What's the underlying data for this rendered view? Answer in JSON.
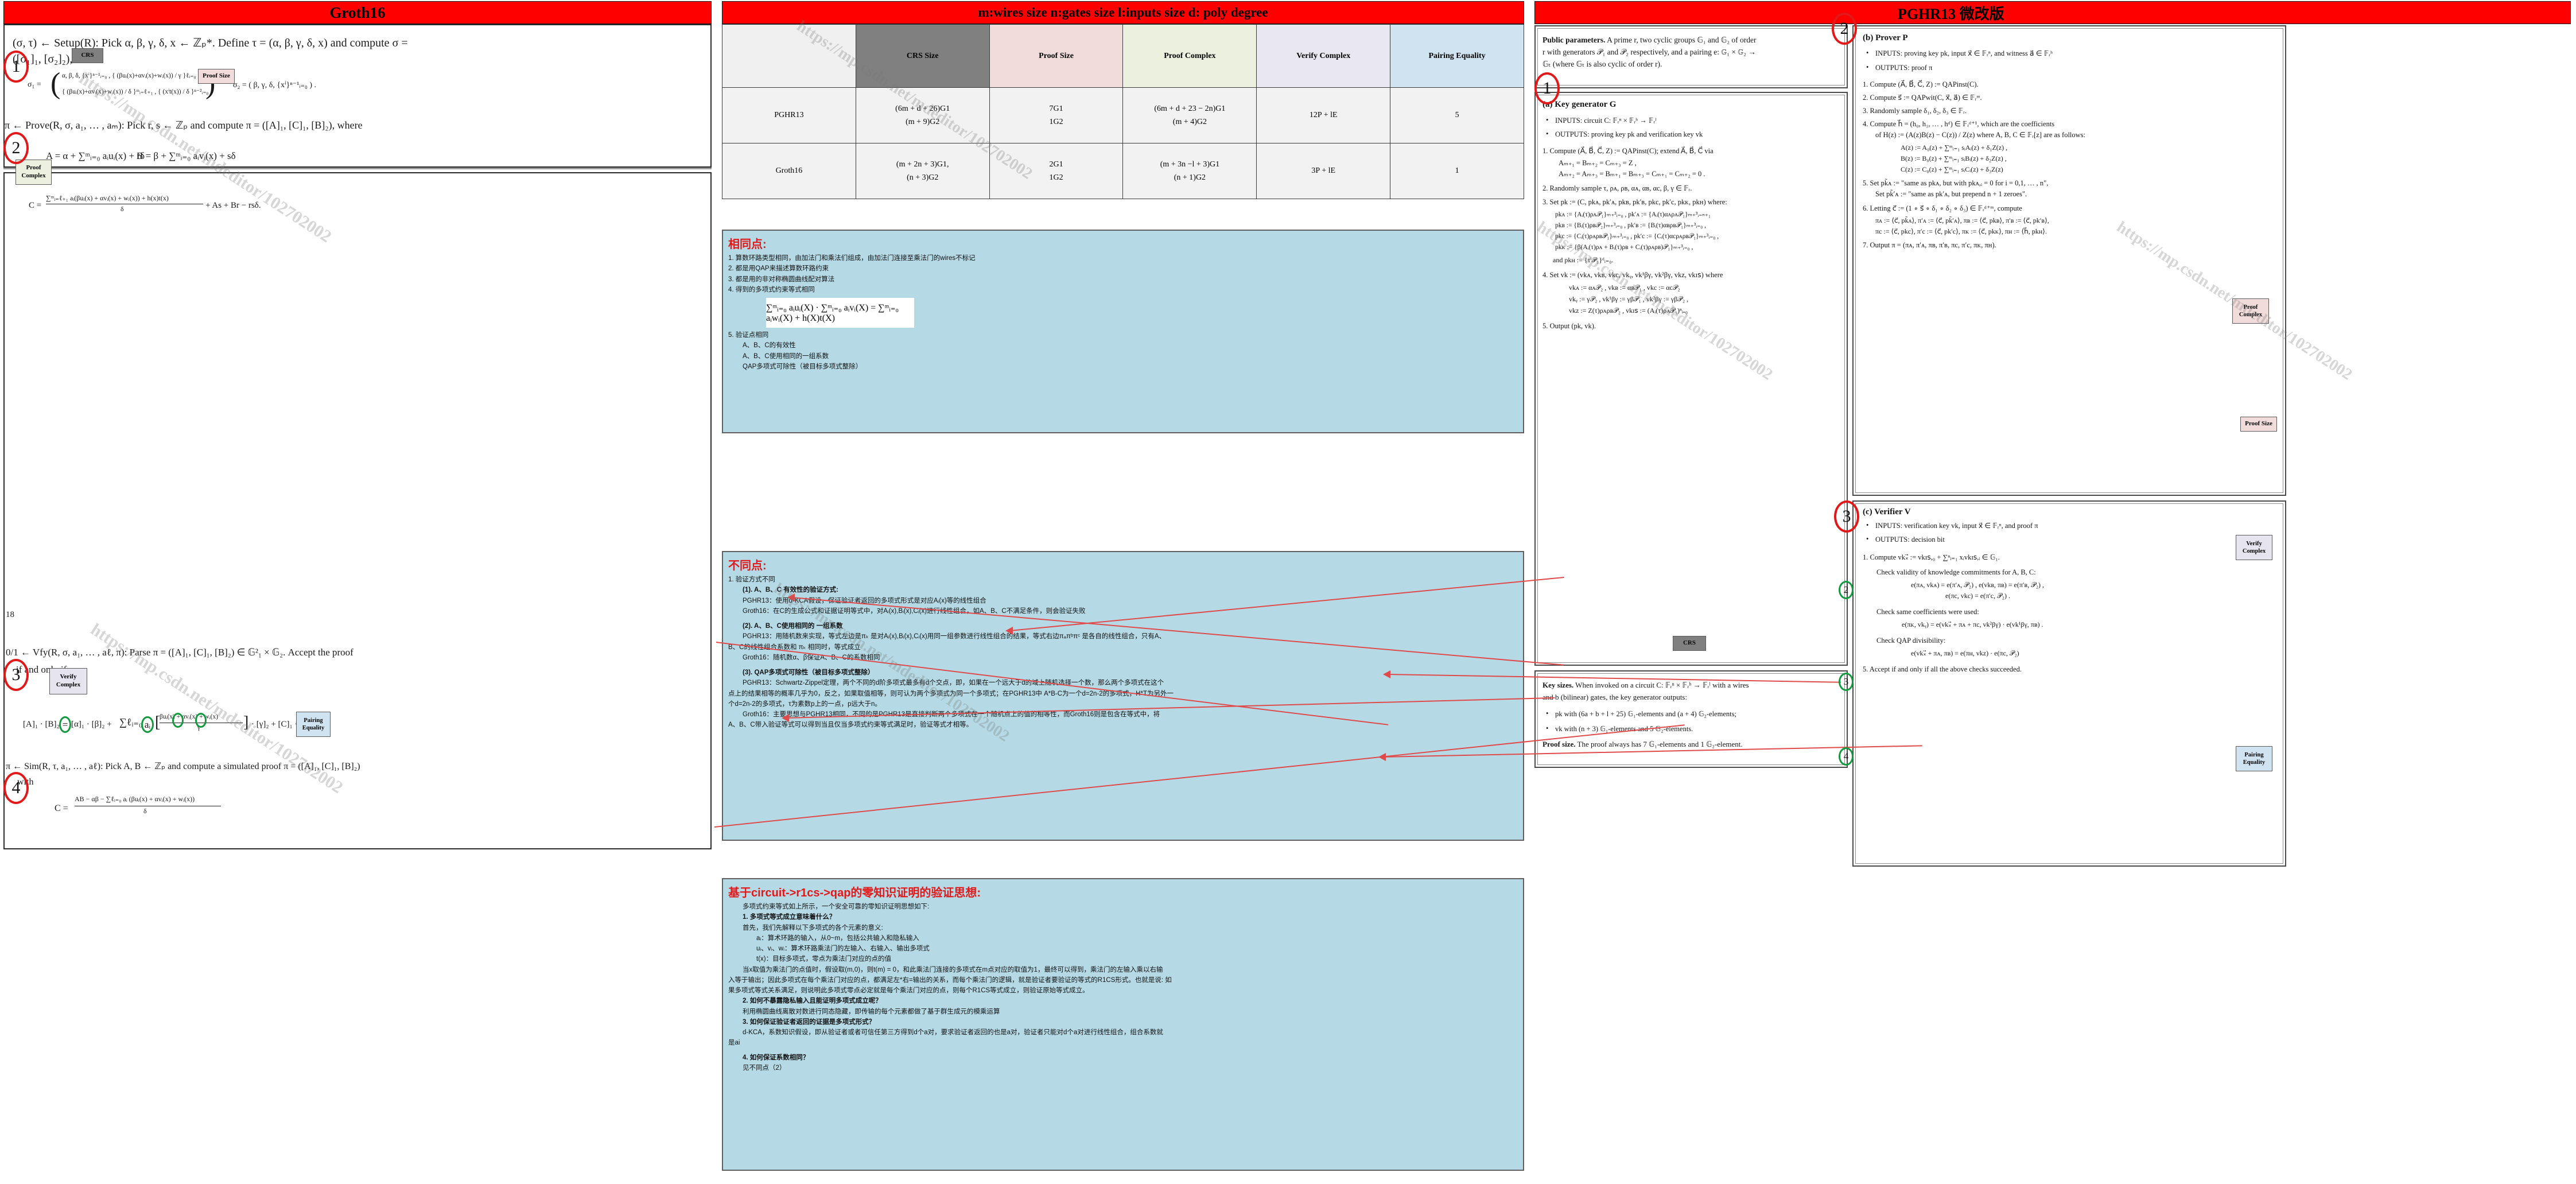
{
  "left": {
    "banner_title": "Groth16",
    "page_number": "18",
    "setup_line1": "(σ, τ) ← Setup(R): Pick α, β, γ, δ, x ← ℤₚ*. Define τ = (α, β, γ, δ, x) and compute σ =",
    "setup_line2": "([σ₁]₁, [σ₂]₂), where",
    "sigma1_row1": "α, β, δ, {xⁱ}ⁿ⁻¹ᵢ₌₀ , { (βuᵢ(x)+αvᵢ(x)+wᵢ(x)) / γ }ℓᵢ₌₀",
    "sigma1_row2": "{ (βuᵢ(x)+αvᵢ(x)+wᵢ(x)) / δ }ᵐᵢ₌ℓ₊₁ , { (xⁱt(x)) / δ }ⁿ⁻²ᵢ₌₀",
    "sigma1_lhs": "σ₁ =",
    "sigma2": "σ₂ = ( β, γ, δ, {xⁱ}ⁿ⁻¹ᵢ₌₀ ) .",
    "prove_line": "π ← Prove(R, σ, a₁, … , aₘ): Pick r, s ← ℤₚ and compute π = ([A]₁, [C]₁, [B]₂), where",
    "eq_A": "A = α + ∑ᵐᵢ₌₀ aᵢuᵢ(x) + rδ",
    "eq_B": "B = β + ∑ᵐᵢ₌₀ aᵢvᵢ(x) + sδ",
    "eq_C_num": "∑ᵐᵢ₌ℓ₊₁ aᵢ(βuᵢ(x) + αvᵢ(x) + wᵢ(x)) + h(x)t(x)",
    "eq_C_den": "δ",
    "eq_C_lhs": "C =",
    "eq_C_tail": "+ As + Br − rsδ.",
    "vfy_line1": "0/1 ← Vfy(R, σ, a₁, … , aℓ, π):  Parse π = ([A]₁, [C]₁, [B]₂) ∈ 𝔾²₁ × 𝔾₂. Accept the proof",
    "vfy_line2": "if and only if",
    "vfy_eq_a": "[A]₁ · [B]₂",
    "vfy_eq_eq": "=",
    "vfy_eq_b": "[α]₁ · [β]₂ +",
    "vfy_eq_sum": "∑ℓᵢ₌₀",
    "vfy_eq_ai": "aᵢ",
    "vfy_eq_frac_num": "βuᵢ(x) + αvᵢ(x) + wᵢ(x)",
    "vfy_eq_frac_den": "γ",
    "vfy_eq_tail": "· [γ]₂ + [C]₁ · [δ]₂.",
    "sim_line1": "π ← Sim(R, τ, a₁, … , aℓ): Pick A, B ← ℤₚ and compute a simulated proof π = ([A]₁, [C]₁, [B]₂)",
    "sim_line2": "with",
    "sim_C_lhs": "C =",
    "sim_C_num": "AB − αβ − ∑ℓᵢ₌₀ aᵢ (βuᵢ(x) + αvᵢ(x) + wᵢ(x))",
    "sim_C_den": "δ",
    "markers": [
      "1",
      "2",
      "3",
      "4"
    ],
    "tags": {
      "crs": "CRS",
      "proof_size": "Proof Size",
      "proof_complex": [
        "Proof",
        "Complex"
      ],
      "verify_complex": [
        "Verify",
        "Complex"
      ],
      "pairing_equality": [
        "Pairing",
        "Equality"
      ]
    }
  },
  "middle": {
    "banner_title": "m:wires size  n:gates size l:inputs size d: poly degree",
    "table": {
      "headers": [
        "",
        "CRS Size",
        "Proof Size",
        "Proof Complex",
        "Verify Complex",
        "Pairing Equality"
      ],
      "rows": [
        {
          "name": "PGHR13",
          "crs_size": [
            "(6m + d + 26)G1",
            "(m + 9)G2"
          ],
          "proof_size": [
            "7G1",
            "1G2"
          ],
          "proof_complex": [
            "(6m + d + 23 − 2n)G1",
            "(m + 4)G2"
          ],
          "verify_complex": "12P + lE",
          "pairing_equality": "5"
        },
        {
          "name": "Groth16",
          "crs_size": [
            "(m + 2n + 3)G1,",
            "(n + 3)G2"
          ],
          "proof_size": [
            "2G1",
            "1G2"
          ],
          "proof_complex": [
            "(m + 3n −l + 3)G1",
            "(n + 1)G2"
          ],
          "verify_complex": "3P + lE",
          "pairing_equality": "1"
        }
      ]
    },
    "same_box": {
      "title": "相同点:",
      "items": [
        "1. 算数环路类型相同，由加法门和乘法们组成，由加法门连接至乘法门的wires不标记",
        "2. 都是用QAP来描述算数环路约束",
        "3. 都是用的非对称椭圆曲线配对算法",
        "4. 得到的多项式约束等式相同"
      ],
      "formula": "∑ᵐᵢ₌₀ aᵢuᵢ(X) · ∑ᵐᵢ₌₀ aᵢvᵢ(X) = ∑ᵐᵢ₌₀ aᵢwᵢ(X) + h(X)t(X)",
      "items2": [
        "5. 验证点相同",
        "A、B、C的有效性",
        "A、B、C使用相同的一组系数",
        "QAP多项式可除性（被目标多项式整除）"
      ]
    },
    "diff_box": {
      "title": "不同点:",
      "l1": "1. 验证方式不同",
      "s1_title": "(1). A、B、C 有效性的验证方式:",
      "s1_a": "PGHR13：使用d-KCA假设，保证验证者返回的多项式形式是对应Aᵢ(x)等的线性组合",
      "s1_b": "Groth16：在C的生成公式和证据证明等式中，对Aᵢ(x),Bᵢ(x),Cᵢ(x)进行线性组合，如A、B、C不满足条件，则会验证失败",
      "s2_title": "(2). A、B、C使用相同的 一组系数",
      "s2_a": "PGHR13：用随机数来实现，等式左边是πₖ 是对Aᵢ(x),Bᵢ(x),Cᵢ(x)用同一组参数进行线性组合的结果，等式右边πₐπᵇπᶜ 是各自的线性组合，只有A、",
      "s2_a2": "B、C的线性组合系数和 πₖ 相同时，等式成立",
      "s2_b": "Groth16：随机数α、β保证A、B、C的系数相同",
      "s3_title": "(3). QAP多项式可除性（被目标多项式整除）",
      "s3_a": "PGHR13：Schwartz-Zippel定理，两个不同的d阶多项式最多有d个交点，即，如果在一个远大于d的域上随机选择一个数，那么两个多项式在这个",
      "s3_a2": "点上的结果相等的概率几乎为0，反之，如果取值相等，则可认为两个多项式为同一个多项式；在PGHR13中 A*B-C为一个d=2n-2的多项式，H*T为另外一",
      "s3_a3": "个d=2n-2的多项式，τ为素数p上的一点，p远大于n。",
      "s3_b": "Groth16：主要思想与PGHR13相同，不同的是PGHR13是直接判断两个多项式在一个随机点上的值的相等性，而Groth16则是包含在等式中，将",
      "s3_b2": "A、B、C带入验证等式可以得到当且仅当多项式约束等式满足时，验证等式才相等。"
    },
    "idea_box": {
      "title": "基于circuit->r1cs->qap的零知识证明的验证思想:",
      "intro": "多项式约束等式如上所示，一个安全可靠的零知识证明思想如下:",
      "q1": "1. 多项式等式成立意味着什么？",
      "q1_a": "首先，我们先解释以下多项式的各个元素的意义:",
      "q1_b1": "aᵢ：算术环路的输入，从0~m，包括公共输入和隐私输入",
      "q1_b2": "uᵢ、vᵢ、wᵢ：算术环路乘法门的左输入、右输入、输出多项式",
      "q1_b3": "t(x)：目标多项式，零点为乘法门对应的点的值",
      "q1_c": "当x取值为乘法门的点值时，假设取(m,0)，则t(m) = 0，和此乘法门连接的多项式在m点对应的取值为1，最终可以得到，乘法门的左输入乘以右输",
      "q1_c2": "入等于输出；因此多项式在每个乘法门对应的点，都满足左*右=输出的关系，而每个乘法门的逻辑，就是验证者要验证的等式的R1CS形式。也就是说: 如",
      "q1_c3": "果多项式等式关系满足，则说明此多项式零点必定就是每个乘法门对应的点，则每个R1CS等式成立，则验证原始等式成立。",
      "q2": "2. 如何不暴露隐私输入且能证明多项式成立呢？",
      "q2_a": "利用椭圆曲线离散对数进行同态隐藏，即传输的每个元素都做了基于群生成元的模乘运算",
      "q3": "3. 如何保证验证者返回的证据是多项式形式？",
      "q3_a": "d-KCA，系数知识假设，即从验证者或者可信任第三方得到d个a对，要求验证者返回的也是a对，验证者只能对d个a对进行线性组合，组合系数就",
      "q3_a2": "是ai",
      "q4": "4. 如何保证系数相同？",
      "q4_a": "见不同点（2）"
    }
  },
  "right": {
    "banner_title": "PGHR13 微改版",
    "public_params": {
      "head": "Public parameters.",
      "l1": " A prime r, two cyclic groups 𝔾₁ and 𝔾₂ of order",
      "l2": "r with generators 𝒫₁ and 𝒫₂ respectively, and a pairing e: 𝔾₁ × 𝔾₂ →",
      "l3": "𝔾ₜ (where 𝔾ₜ is also cyclic of order r)."
    },
    "keygen": {
      "title": "(a) Key generator G",
      "inputs": "INPUTS: circuit C: 𝔽ᵣⁿ × 𝔽ᵣʰ → 𝔽ᵣˡ",
      "outputs": "OUTPUTS: proving key pk and verification key vk",
      "s1": "1. Compute (A⃗, B⃗, C⃗, Z) := QAPinst(C); extend A⃗, B⃗, C⃗ via",
      "s1a": "Aₘ₊₁ = Bₘ₊₂ = Cₘ₊₃ = Z ,",
      "s1b": "Aₘ₊₂ = Aₘ₊₃ = Bₘ₊₁ = Bₘ₊₃ = Cₘ₊₁ = Cₘ₊₂ = 0 .",
      "s2": "2. Randomly sample τ, ρᴀ, ρʙ, αᴀ, αʙ, αc, β, γ ∈ 𝔽ᵣ.",
      "s3": "3. Set pk := (C, pkᴀ, pk′ᴀ, pkʙ, pk′ʙ, pkc, pk′c, pkᴋ, pkʜ) where:",
      "pkA": "pkᴀ := {Aᵢ(τ)ρᴀ𝒫₁}ₘ₊³ᵢ₌₀ ,    pk′ᴀ := {Aᵢ(τ)αᴀρᴀ𝒫₁}ₘ₊³ᵢ₌ₙ₊₁",
      "pkB": "pkʙ := {Bᵢ(τ)ρʙ𝒫₂}ₘ₊³ᵢ₌₀ ,    pk′ʙ := {Bᵢ(τ)αʙρʙ𝒫₁}ₘ₊³ᵢ₌₀ ,",
      "pkC": "pkc := {Cᵢ(τ)ρᴀρʙ𝒫₁}ₘ₊³ᵢ₌₀ , pk′c := {Cᵢ(τ)αcρᴀρʙ𝒫₁}ₘ₊³ᵢ₌₀ ,",
      "pkK": "pkᴋ := {β(Aᵢ(τ)ρᴀ + Bᵢ(τ)ρʙ + Cᵢ(τ)ρᴀρʙ)𝒫₁}ₘ₊³ᵢ₌₀ ,",
      "pkH": "and pkʜ := {τⁱ𝒫₁}ᵈᵢ₌₀.",
      "s4": "4. Set vk := (vkᴀ, vkʙ, vkc, vkᵧ, vk¹βγ, vk²βγ, vkᴢ, vkɪꜱ) where",
      "vk1": "vkᴀ := αᴀ𝒫₂ , vkʙ := αʙ𝒫₁ , vkc := αc𝒫₂",
      "vk2": "vkᵧ := γ𝒫₂ ,    vk¹βγ := γβ𝒫₁ ,  vk²βγ := γβ𝒫₂ ,",
      "vk3": "vkᴢ := Z(τ)ρᴀρʙ𝒫₂ , vkɪꜱ := (Aᵢ(τ)ρᴀ𝒫₁)ⁿᵢ₌₀",
      "s5": "5. Output (pk, vk)."
    },
    "keysizes": {
      "head": "Key sizes.",
      "l1": " When invoked on a circuit C: 𝔽ᵣⁿ × 𝔽ᵣʰ → 𝔽ᵣˡ with a wires",
      "l2": "and b (bilinear) gates, the key generator outputs:",
      "b1": "pk with (6a + b + l + 25) 𝔾₁-elements and (a + 4) 𝔾₂-elements;",
      "b2": "vk with (n + 3) 𝔾₁-elements and 5 𝔾₂-elements.",
      "proofsize_head": "Proof size.",
      "proofsize_l": " The proof always has 7 𝔾₁-elements and 1 𝔾₂-element."
    },
    "prover": {
      "title": "(b) Prover P",
      "inputs": "INPUTS: proving key pk, input x⃗ ∈ 𝔽ᵣⁿ, and witness a⃗ ∈ 𝔽ᵣʰ",
      "outputs": "OUTPUTS: proof π",
      "s1": "1. Compute (A⃗, B⃗, C⃗, Z) := QAPinst(C).",
      "s2": "2. Compute s⃗ := QAPwit(C, x⃗, a⃗) ∈ 𝔽ᵣᵐ.",
      "s3": "3. Randomly sample δ₁, δ₂, δ₃ ∈ 𝔽ᵣ.",
      "s4a": "4. Compute h⃗ = (h₀, h₁, … , hᵈ) ∈ 𝔽ᵣᵈ⁺¹, which are the coefficients",
      "s4b": "of H(z) := (A(z)B(z) − C(z)) / Z(z) where A, B, C ∈ 𝔽ᵣ[z] are as follows:",
      "Az": "A(z) := A₀(z) + ∑ᵐᵢ₌₁ sᵢAᵢ(z) + δ₁Z(z) ,",
      "Bz": "B(z) := B₀(z) + ∑ᵐᵢ₌₁ sᵢBᵢ(z) + δ₂Z(z) ,",
      "Cz": "C(z) := C₀(z) + ∑ᵐᵢ₌₁ sᵢCᵢ(z) + δ₃Z(z)",
      "s5a": "5. Set pk̃ᴀ := \"same as pkᴀ, but with pkᴀ,ᵢ = 0 for i = 0,1, … , n\",",
      "s5b": "Set pk̃′ᴀ := \"same as pk′ᴀ, but prepend n + 1 zeroes\".",
      "s6": "6. Letting c⃗ := (1 ∘ s⃗ ∘ δ₁ ∘ δ₂ ∘ δ₃) ∈ 𝔽ᵣᵈ⁺ᵐ, compute",
      "pi1": "πᴀ := ⟨c⃗, pk̃ᴀ⟩, π′ᴀ := ⟨c⃗, pk̃′ᴀ⟩, πʙ := ⟨c⃗, pkʙ⟩, π′ʙ := ⟨c⃗, pk′ʙ⟩,",
      "pi2": "πc := ⟨c⃗, pkc⟩, π′c := ⟨c⃗, pk′c⟩, πᴋ := ⟨c⃗, pkᴋ⟩, πʜ := ⟨h⃗, pkʜ⟩.",
      "s7": "7. Output π = (πᴀ, π′ᴀ, πʙ, π′ʙ, πc, π′c, πᴋ, πʜ)."
    },
    "verifier": {
      "title": "(c) Verifier V",
      "inputs": "INPUTS: verification key vk, input x⃗ ∈ 𝔽ᵣⁿ, and proof π",
      "outputs": "OUTPUTS: decision bit",
      "s1": "1. Compute vkₓ⃗ := vkɪꜱ,₀ + ∑ⁿᵢ₌₁ xᵢvkɪꜱ,ᵢ ∈ 𝔾₁.",
      "s2": "Check validity of knowledge commitments for A, B, C:",
      "s2_eq1": "e(πᴀ, vkᴀ) = e(π′ᴀ, 𝒫₂) , e(vkʙ, πʙ) = e(π′ʙ, 𝒫₂) ,",
      "s2_eq2": "e(πc, vkc) = e(π′c, 𝒫₂) .",
      "s3": "Check same coefficients were used:",
      "s3_eq": "e(πᴋ, vkᵧ) = e(vkₓ⃗ + πᴀ + πc, vk²βγ) · e(vk¹βγ, πʙ) .",
      "s4": "Check QAP divisibility:",
      "s4_eq": "e(vkₓ⃗ + πᴀ, πʙ) = e(πʜ, vkᴢ) · e(πc, 𝒫₂)",
      "s5": "5. Accept if and only if all the above checks succeeded."
    },
    "markers_red": [
      "1",
      "2",
      "3"
    ],
    "markers_green": [
      "2",
      "3",
      "4"
    ],
    "tags": {
      "crs": "CRS",
      "proof_size": "Proof Size",
      "proof_complex": [
        "Proof",
        "Complex"
      ],
      "verify_complex": [
        "Verify",
        "Complex"
      ],
      "pairing_equality": [
        "Pairing",
        "Equality"
      ]
    }
  },
  "watermarks": [
    "https://mp.csdn.net/mdeditor/102702002",
    "https://mp.csdn.net/mdeditor/102702002",
    "https://mp.csdn.net/mdeditor/102702002",
    "https://mp.csdn.net/mdeditor/102702002",
    "https://mp.csdn.net/mdeditor/102702002",
    "https://mp.csdn.net/mdeditor/102702002"
  ]
}
